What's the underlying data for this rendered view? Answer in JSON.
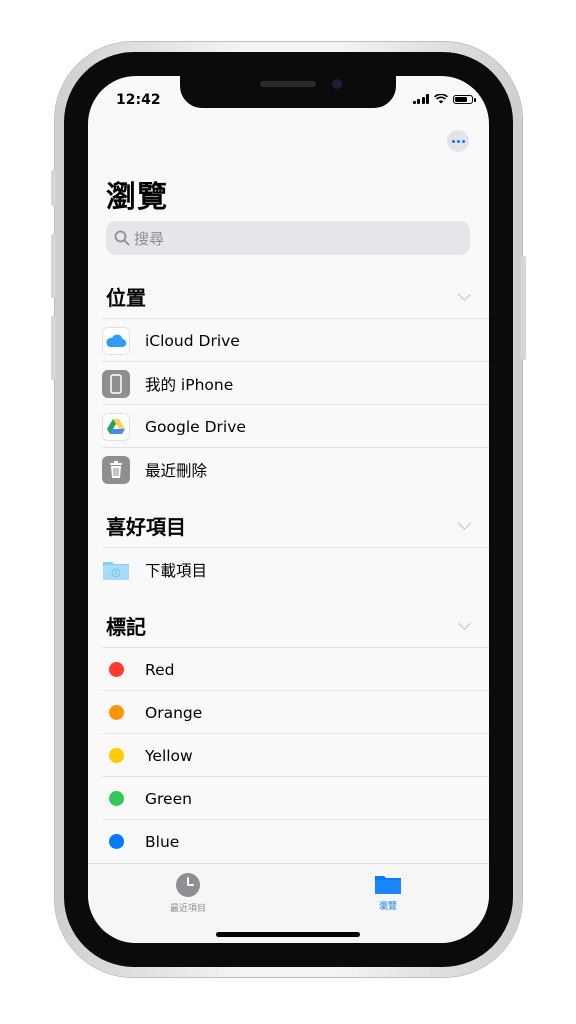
{
  "status_bar": {
    "time": "12:42",
    "battery_level": 0.8
  },
  "header": {
    "title": "瀏覽"
  },
  "search": {
    "placeholder": "搜尋"
  },
  "sections": {
    "locations": {
      "title": "位置",
      "items": [
        {
          "label": "iCloud Drive",
          "icon": "icloud-icon"
        },
        {
          "label": "我的 iPhone",
          "icon": "iphone-icon"
        },
        {
          "label": "Google Drive",
          "icon": "google-drive-icon"
        },
        {
          "label": "最近刪除",
          "icon": "trash-icon"
        }
      ]
    },
    "favorites": {
      "title": "喜好項目",
      "items": [
        {
          "label": "下載項目",
          "icon": "downloads-folder-icon"
        }
      ]
    },
    "tags": {
      "title": "標記",
      "items": [
        {
          "label": "Red",
          "color": "#ff3b30"
        },
        {
          "label": "Orange",
          "color": "#ff9500"
        },
        {
          "label": "Yellow",
          "color": "#ffcc00"
        },
        {
          "label": "Green",
          "color": "#34c759"
        },
        {
          "label": "Blue",
          "color": "#007aff"
        }
      ]
    }
  },
  "tab_bar": {
    "tabs": [
      {
        "label": "最近項目",
        "icon": "clock-icon",
        "active": false
      },
      {
        "label": "瀏覽",
        "icon": "folder-icon",
        "active": true
      }
    ]
  },
  "colors": {
    "accent": "#007aff",
    "inactive": "#8e8e93"
  }
}
